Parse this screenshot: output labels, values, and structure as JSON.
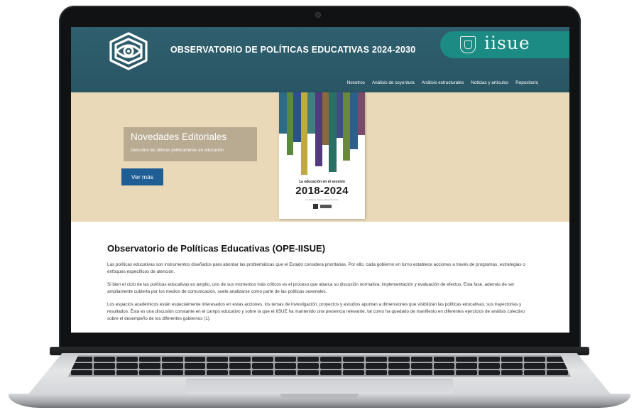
{
  "header": {
    "site_title": "OBSERVATORIO DE POLÍTICAS EDUCATIVAS 2024-2030",
    "partner_wordmark": "iisue",
    "icons": {
      "logo": "eye-hexagon-logo-icon",
      "crest": "unam-crest-icon"
    },
    "nav": [
      {
        "label": "Nosotros"
      },
      {
        "label": "Análisis de coyuntura"
      },
      {
        "label": "Análisis estructurales"
      },
      {
        "label": "Noticias y artículos"
      },
      {
        "label": "Repositorio"
      }
    ]
  },
  "hero": {
    "card_title": "Novedades Editoriales",
    "card_subtitle": "Descubre las últimas publicaciones en educación.",
    "button_label": "Ver más",
    "book": {
      "label": "La educación en el sexenio",
      "years": "2018-2024",
      "caption": "Un balance de la política educativa"
    }
  },
  "main": {
    "title": "Observatorio de Políticas Educativas (OPE-IISUE)",
    "paragraphs": [
      "Las políticas educativas son instrumentos diseñados para abordar las problemáticas que el Estado considera prioritarias. Por ello, cada gobierno en turno establece acciones a través de programas, estrategias o enfoques específicos de atención.",
      "Si bien el ciclo de las políticas educativas es amplio, uno de sus momentos más críticos es el proceso que abarca su discusión normativa, implementación y evaluación de efectos. Esta fase, además de ser ampliamente cubierta por los medios de comunicación, suele analizarse como parte de las políticas sexenales.",
      "Los espacios académicos están especialmente interesados en estas acciones, los temas de investigación, proyectos y estudios apuntan a dimensiones que visibilizan las políticas educativas, sus trayectorias y resultados. Ésta es una discusión constante en el campo educativo y sobre la que el IISUE ha mantenido una presencia relevante, tal como ha quedado de manifiesto en diferentes ejercicios de análisis colectivo sobre el desempeño de los diferentes gobiernos (1)."
    ]
  },
  "colors": {
    "header": "#2f5f6e",
    "partner": "#1b8b84",
    "hero_bg": "#e9d9b9",
    "card": "#b9ab92",
    "button": "#1f5e95"
  }
}
